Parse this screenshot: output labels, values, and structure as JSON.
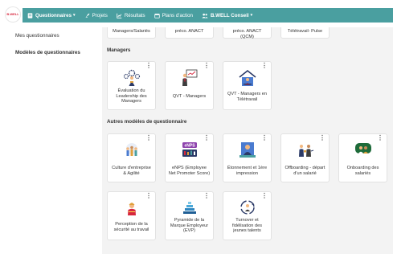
{
  "brand": {
    "logo_text": "B.WELL"
  },
  "nav": {
    "items": [
      {
        "id": "questionnaires",
        "label": "Questionnaires",
        "caret": "▾",
        "icon": "form-icon"
      },
      {
        "id": "projets",
        "label": "Projets",
        "icon": "rocket-icon"
      },
      {
        "id": "resultats",
        "label": "Résultats",
        "icon": "chart-icon"
      },
      {
        "id": "plans",
        "label": "Plans d'action",
        "icon": "calendar-icon"
      },
      {
        "id": "account",
        "label": "B.WELL Conseil",
        "caret": "▾",
        "icon": "users-icon"
      }
    ],
    "bar_color": "#4a9fa0"
  },
  "sidebar": {
    "items": [
      {
        "label": "Mes questionnaires",
        "active": false
      },
      {
        "label": "Modèles de questionnaires",
        "active": true
      }
    ]
  },
  "main": {
    "top_cards": [
      {
        "label": "Managers/Salariés"
      },
      {
        "label": "préco. ANACT"
      },
      {
        "label": "préco. ANACT (QCM)"
      },
      {
        "label": "Télétravail- Pulse"
      }
    ],
    "managers_section": {
      "title": "Managers",
      "cards": [
        {
          "label": "Évaluation du Leadership des Managers",
          "icon": "leader-gears-icon"
        },
        {
          "label": "QVT - Managers",
          "icon": "manager-board-icon"
        },
        {
          "label": "QVT - Managers en Télétravail",
          "icon": "home-office-icon"
        }
      ]
    },
    "autres_section": {
      "title": "Autres modèles de questionnaire",
      "cards": [
        {
          "label": "Culture d'entreprise & Agilité",
          "icon": "team-culture-icon"
        },
        {
          "label": "eNPS (Employee Net Promoter Score)",
          "icon": "enps-icon",
          "badge": "eNPS"
        },
        {
          "label": "Étonnement et 1ère impression",
          "icon": "astonished-icon"
        },
        {
          "label": "Offboarding - départ d'un salarié",
          "icon": "offboarding-icon"
        },
        {
          "label": "Onboarding des salariés",
          "icon": "onboarding-icon"
        },
        {
          "label": "Perception de la sécurité au travail",
          "icon": "safety-icon"
        },
        {
          "label": "Pyramide de la Marque Employeur (EVP)",
          "icon": "pyramid-icon"
        },
        {
          "label": "Turnover et fidélisation des jeunes talents",
          "icon": "turnover-icon"
        }
      ]
    },
    "menu_glyph": "⋮"
  }
}
